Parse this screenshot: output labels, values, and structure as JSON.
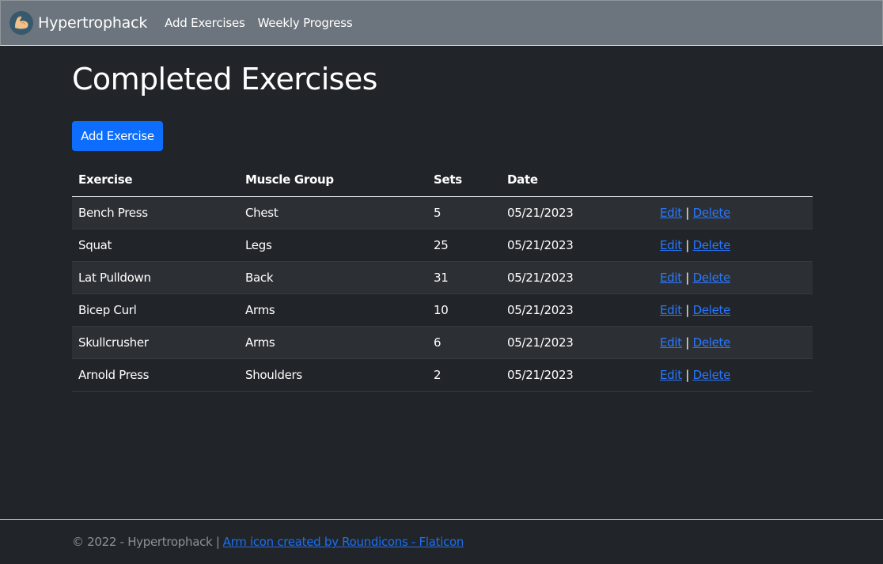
{
  "nav": {
    "brand": "Hypertrophack",
    "links": [
      "Add Exercises",
      "Weekly Progress"
    ]
  },
  "main": {
    "title": "Completed Exercises",
    "add_button": "Add Exercise"
  },
  "table": {
    "headers": [
      "Exercise",
      "Muscle Group",
      "Sets",
      "Date",
      ""
    ],
    "edit_label": "Edit",
    "separator": "|",
    "delete_label": "Delete",
    "rows": [
      [
        "Bench Press",
        "Chest",
        "5",
        "05/21/2023"
      ],
      [
        "Squat",
        "Legs",
        "25",
        "05/21/2023"
      ],
      [
        "Lat Pulldown",
        "Back",
        "31",
        "05/21/2023"
      ],
      [
        "Bicep Curl",
        "Arms",
        "10",
        "05/21/2023"
      ],
      [
        "Skullcrusher",
        "Arms",
        "6",
        "05/21/2023"
      ],
      [
        "Arnold Press",
        "Shoulders",
        "2",
        "05/21/2023"
      ]
    ]
  },
  "footer": {
    "copyright": "© 2022 - Hypertrophack |",
    "credit_link": "Arm icon created by Roundicons - Flaticon"
  },
  "colors": {
    "navbar": "#6c757d",
    "page_bg": "#212529",
    "primary": "#0d6efd",
    "link": "#2a78ff"
  },
  "icons": {
    "brand_logo": "flexed-arm-icon"
  }
}
